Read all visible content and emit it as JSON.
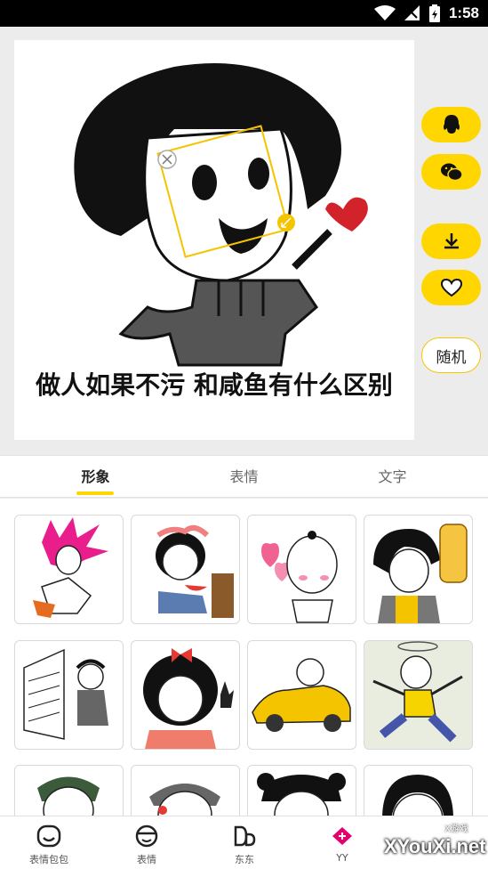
{
  "status_bar": {
    "time": "1:58"
  },
  "canvas": {
    "caption": "做人如果不污 和咸鱼有什么区别"
  },
  "side_actions": {
    "qq": "qq-icon",
    "wechat": "wechat-icon",
    "download": "download-icon",
    "favorite": "heart-icon",
    "random_label": "随机"
  },
  "tabs": [
    {
      "label": "形象",
      "active": true
    },
    {
      "label": "表情",
      "active": false
    },
    {
      "label": "文字",
      "active": false
    }
  ],
  "bottom_nav": [
    {
      "label": "表情包包",
      "icon": "face-icon"
    },
    {
      "label": "表情",
      "icon": "emoji-face-icon"
    },
    {
      "label": "东东",
      "icon": "dd-icon"
    },
    {
      "label": "YY",
      "icon": "gamepad-icon"
    }
  ],
  "watermark": {
    "text": "XYouXi.net",
    "small": "X游戏"
  },
  "colors": {
    "accent": "#ffd600",
    "text": "#222222"
  }
}
